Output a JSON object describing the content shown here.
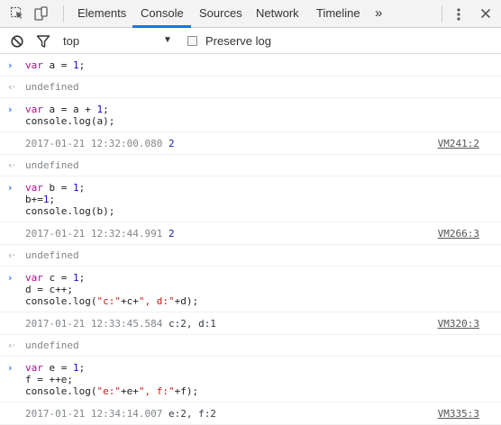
{
  "tabs": [
    "Elements",
    "Console",
    "Sources",
    "Network",
    "Timeline"
  ],
  "toolbar": {
    "more_tabs": "»",
    "context": "top",
    "preserve_log": "Preserve log"
  },
  "entries": [
    {
      "kind": "cmd",
      "lines": [
        "var a = 1;"
      ]
    },
    {
      "kind": "res",
      "text": "undefined"
    },
    {
      "kind": "cmd",
      "lines": [
        "var a = a + 1;",
        "console.log(a);"
      ]
    },
    {
      "kind": "log",
      "timestamp": "2017-01-21 12:32:00.080",
      "value": "2",
      "source": "VM241:2"
    },
    {
      "kind": "res",
      "text": "undefined"
    },
    {
      "kind": "cmd",
      "lines": [
        "var b = 1;",
        "b+=1;",
        "console.log(b);"
      ]
    },
    {
      "kind": "log",
      "timestamp": "2017-01-21 12:32:44.991",
      "value": "2",
      "source": "VM266:3"
    },
    {
      "kind": "res",
      "text": "undefined"
    },
    {
      "kind": "cmd",
      "lines": [
        "var c = 1;",
        "d = c++;",
        "console.log(\"c:\"+c+\", d:\"+d);"
      ]
    },
    {
      "kind": "log",
      "timestamp": "2017-01-21 12:33:45.584",
      "value": "c:2, d:1",
      "source": "VM320:3"
    },
    {
      "kind": "res",
      "text": "undefined"
    },
    {
      "kind": "cmd",
      "lines": [
        "var e = 1;",
        "f = ++e;",
        "console.log(\"e:\"+e+\", f:\"+f);"
      ]
    },
    {
      "kind": "log",
      "timestamp": "2017-01-21 12:34:14.007",
      "value": "e:2, f:2",
      "source": "VM335:3"
    }
  ],
  "colors": {
    "accent": "#1a73e8",
    "keyword": "#aa0d91",
    "number": "#1c00cf",
    "string": "#c41a16"
  }
}
